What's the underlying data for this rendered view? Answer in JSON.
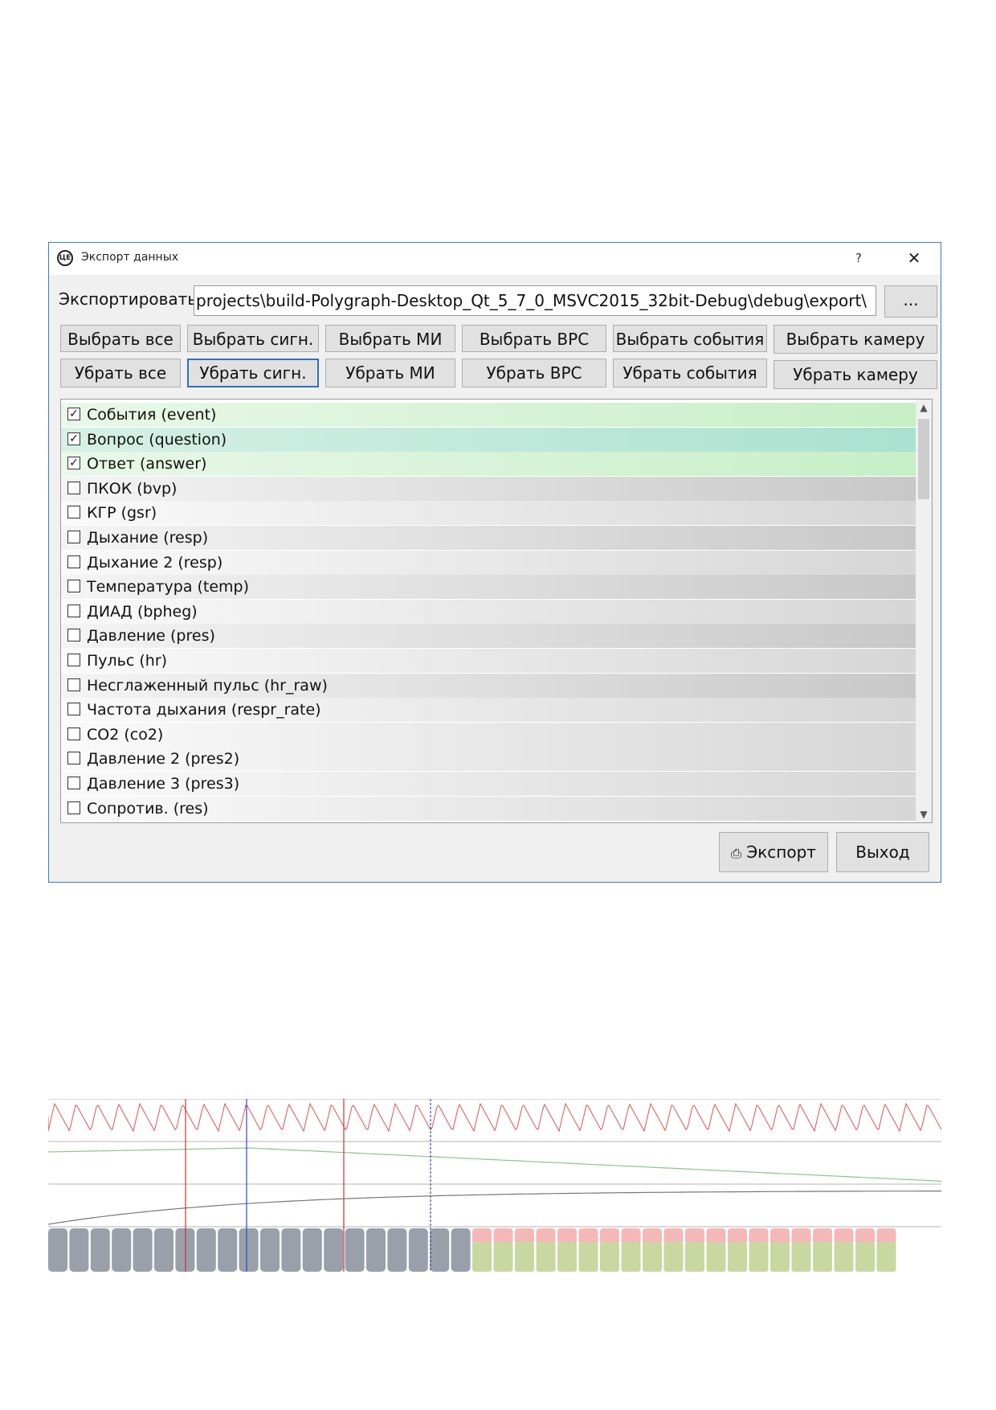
{
  "window": {
    "title": "Экспорт данных",
    "icon": "polygraph-logo-icon",
    "help_label": "?",
    "close_label": "✕"
  },
  "export_row": {
    "label": "Экспортировать",
    "path": "projects\\build-Polygraph-Desktop_Qt_5_7_0_MSVC2015_32bit-Debug\\debug\\export\\",
    "browse_label": "..."
  },
  "select_buttons": [
    "Выбрать все",
    "Выбрать сигн.",
    "Выбрать МИ",
    "Выбрать ВРС",
    "Выбрать события",
    "Выбрать камеру"
  ],
  "deselect_buttons": [
    "Убрать все",
    "Убрать сигн.",
    "Убрать МИ",
    "Убрать ВРС",
    "Убрать события",
    "Убрать камеру"
  ],
  "channels": [
    {
      "label": "События (event)",
      "checked": true
    },
    {
      "label": "Вопрос (question)",
      "checked": true
    },
    {
      "label": "Ответ (answer)",
      "checked": true
    },
    {
      "label": "ПКОК (bvp)",
      "checked": false
    },
    {
      "label": "КГР (gsr)",
      "checked": false
    },
    {
      "label": "Дыхание (resp)",
      "checked": false
    },
    {
      "label": "Дыхание 2 (resp)",
      "checked": false
    },
    {
      "label": "Температура (temp)",
      "checked": false
    },
    {
      "label": "ДИАД (bpheg)",
      "checked": false
    },
    {
      "label": "Давление (pres)",
      "checked": false
    },
    {
      "label": "Пульс (hr)",
      "checked": false
    },
    {
      "label": "Несглаженный пульс (hr_raw)",
      "checked": false
    },
    {
      "label": "Частота дыхания (respr_rate)",
      "checked": false
    },
    {
      "label": "CO2 (co2)",
      "checked": false
    },
    {
      "label": "Давление 2 (pres2)",
      "checked": false
    },
    {
      "label": "Давление 3 (pres3)",
      "checked": false
    },
    {
      "label": "Сопротив. (res)",
      "checked": false
    }
  ],
  "footer": {
    "export_label": "Экспорт",
    "export_icon": "export-icon",
    "exit_label": "Выход"
  },
  "waveform": {
    "pulse_color": "#e06060",
    "gsr_color": "#88c888",
    "temp_color": "#777777",
    "grid_color": "#9a9a9a",
    "marker_red": "#cc3333",
    "marker_blue": "#3344cc",
    "block_gray": "#9aa0aa",
    "block_pink": "#f4b8b8",
    "block_green": "#c8d8a0"
  }
}
